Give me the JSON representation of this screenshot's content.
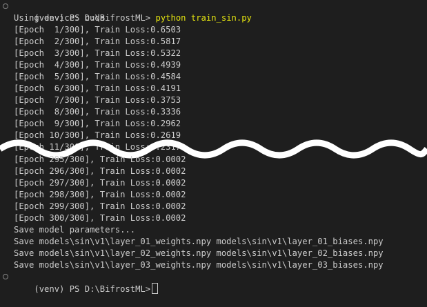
{
  "terminal": {
    "prompt_venv": "(venv)",
    "prompt_path": "PS D:\\BifrostML>",
    "command": "python train_sin.py",
    "lines_top": [
      "Using device: cuda",
      "[Epoch  1/300], Train Loss:0.6503",
      "[Epoch  2/300], Train Loss:0.5817",
      "[Epoch  3/300], Train Loss:0.5322",
      "[Epoch  4/300], Train Loss:0.4939",
      "[Epoch  5/300], Train Loss:0.4584",
      "[Epoch  6/300], Train Loss:0.4191",
      "[Epoch  7/300], Train Loss:0.3753",
      "[Epoch  8/300], Train Loss:0.3336",
      "[Epoch  9/300], Train Loss:0.2962",
      "[Epoch 10/300], Train Loss:0.2619",
      "[Epoch 11/300], Train Loss:0.2317"
    ],
    "lines_bottom": [
      "[Epoch 295/300], Train Loss:0.0002",
      "[Epoch 296/300], Train Loss:0.0002",
      "[Epoch 297/300], Train Loss:0.0002",
      "[Epoch 298/300], Train Loss:0.0002",
      "[Epoch 299/300], Train Loss:0.0002",
      "[Epoch 300/300], Train Loss:0.0002",
      "Save model parameters...",
      "Save models\\sin\\v1\\layer_01_weights.npy models\\sin\\v1\\layer_01_biases.npy",
      "Save models\\sin\\v1\\layer_02_weights.npy models\\sin\\v1\\layer_02_biases.npy",
      "Save models\\sin\\v1\\layer_03_weights.npy models\\sin\\v1\\layer_03_biases.npy"
    ],
    "final_prompt": "(venv) PS D:\\BifrostML>"
  },
  "colors": {
    "background": "#1e1e1e",
    "text": "#cccccc",
    "command": "#e5e510",
    "wave": "#ffffff"
  },
  "icons": {
    "status_dot": "circle-outline-icon"
  }
}
